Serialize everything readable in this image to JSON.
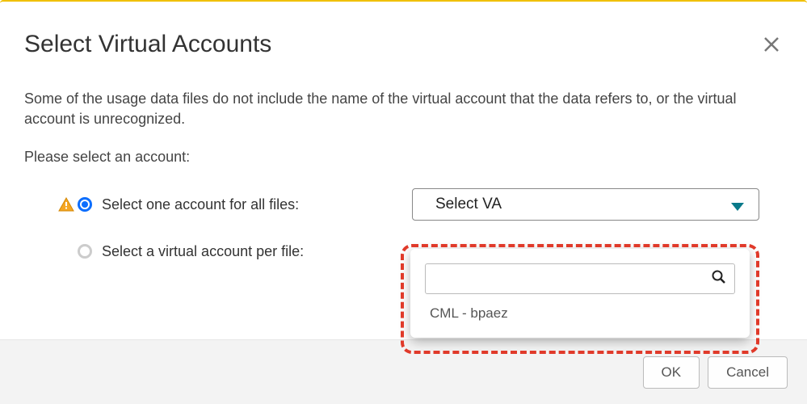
{
  "modal": {
    "title": "Select Virtual Accounts",
    "description": "Some of the usage data files do not include the name of the virtual account that the data refers to, or the virtual account is unrecognized.",
    "prompt": "Please select an account:"
  },
  "options": {
    "opt1_label": "Select one account for all files:",
    "opt2_label": "Select a virtual account per file:",
    "selected": "opt1"
  },
  "select": {
    "placeholder": "Select VA"
  },
  "dropdown": {
    "search_value": "",
    "items": [
      "CML - bpaez"
    ]
  },
  "footer": {
    "ok": "OK",
    "cancel": "Cancel"
  },
  "colors": {
    "accent_blue": "#0d6efd",
    "highlight_red": "#e03a2a",
    "warn_yellow": "#f5a623",
    "top_border": "#f0c000"
  }
}
